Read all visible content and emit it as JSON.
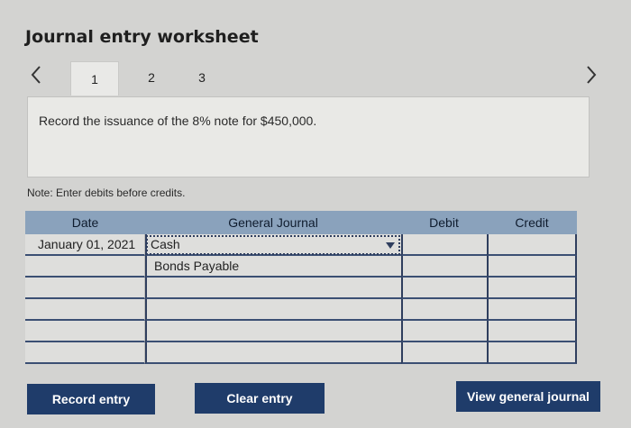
{
  "title": "Journal entry worksheet",
  "tabs": [
    "1",
    "2",
    "3"
  ],
  "active_tab": "1",
  "prompt": "Record the issuance of the 8% note for $450,000.",
  "note": "Note: Enter debits before credits.",
  "table": {
    "headers": {
      "date": "Date",
      "general_journal": "General Journal",
      "debit": "Debit",
      "credit": "Credit"
    },
    "rows": [
      {
        "date": "January 01, 2021",
        "account": "Cash",
        "debit": "",
        "credit": ""
      },
      {
        "date": "",
        "account": "Bonds Payable",
        "debit": "",
        "credit": ""
      },
      {
        "date": "",
        "account": "",
        "debit": "",
        "credit": ""
      },
      {
        "date": "",
        "account": "",
        "debit": "",
        "credit": ""
      },
      {
        "date": "",
        "account": "",
        "debit": "",
        "credit": ""
      },
      {
        "date": "",
        "account": "",
        "debit": "",
        "credit": ""
      }
    ]
  },
  "buttons": {
    "record": "Record entry",
    "clear": "Clear entry",
    "view": "View general journal"
  },
  "icons": {
    "prev": "chevron-left-icon",
    "next": "chevron-right-icon",
    "dropdown": "dropdown-arrow-icon"
  },
  "colors": {
    "button_bg": "#1f3c6a",
    "header_bg": "#8aa2bc",
    "grid_line": "#2f3e5e"
  }
}
